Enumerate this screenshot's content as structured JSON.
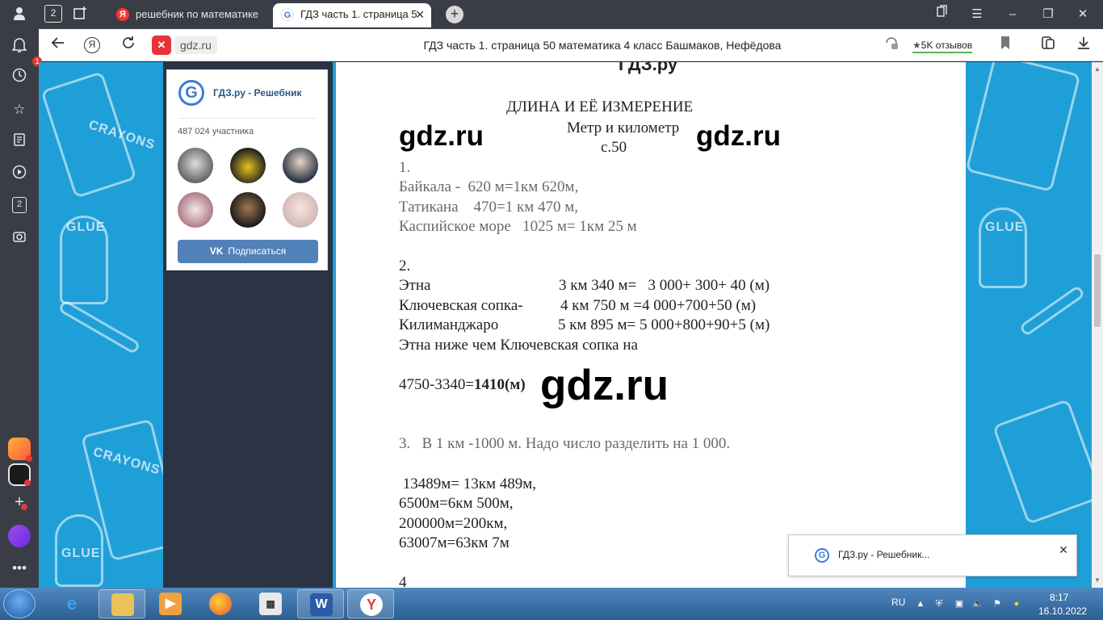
{
  "browser": {
    "tabs": [
      {
        "title": "решебник по математике",
        "favicon": "Я",
        "active": false
      },
      {
        "title": "ГДЗ часть 1. страница 5",
        "favicon": "G",
        "active": true
      }
    ],
    "tab_counter": "2",
    "address": {
      "domain": "gdz.ru",
      "page_title": "ГДЗ часть 1. страница 50 математика 4 класс Башмаков, Нефёдова",
      "reviews": "5K отзывов",
      "notification_count": "2"
    },
    "sidebar": {
      "notification_badge": "1",
      "tab_counter": "2"
    }
  },
  "vk_widget": {
    "group_name": "ГДЗ.ру - Решебник",
    "logo_letter": "G",
    "members": "487 024 участника",
    "subscribe_label": "Подписаться",
    "vk_glyph": "VK"
  },
  "document": {
    "header_partial": "ГДЗ.ру",
    "heading": "ДЛИНА И ЕЁ ИЗМЕРЕНИЕ",
    "subheading": "Метр и километр",
    "page_ref": "с.50",
    "watermark": "gdz.ru",
    "task1": {
      "number": "1.",
      "lines": [
        "Байкала -  620 м=1км 620м,",
        "Татикана    470=1 км 470 м,",
        "Каспийское море   1025 м= 1км 25 м"
      ]
    },
    "task2": {
      "number": "2.",
      "rows": [
        {
          "name": "Этна",
          "value": "3 км 340 м=   3 000+ 300+ 40 (м)"
        },
        {
          "name": "Ключевская сопка-",
          "value": "4 км 750 м =4 000+700+50 (м)"
        },
        {
          "name": "Килиманджаро",
          "value": "5 км 895 м= 5 000+800+90+5 (м)"
        }
      ],
      "conclusion": "Этна ниже чем Ключевская сопка на",
      "calc_prefix": "4750-3340=",
      "calc_result": "1410(м)"
    },
    "task3": {
      "number": "3.",
      "text": "В 1 км -1000 м. Надо число разделить на 1 000.",
      "lines": [
        " 13489м= 13км 489м,",
        "6500м=6км 500м,",
        "200000м=200км,",
        "63007м=63км 7м"
      ]
    },
    "task4_number": "4"
  },
  "popup": {
    "text": "ГДЗ.ру - Решебник...",
    "logo_letter": "G"
  },
  "taskbar": {
    "language": "RU",
    "time": "8:17",
    "date": "16.10.2022"
  },
  "colors": {
    "page_background": "#1f9fd8",
    "vk_button": "#5181b8",
    "browser_chrome": "#3a3d45"
  }
}
